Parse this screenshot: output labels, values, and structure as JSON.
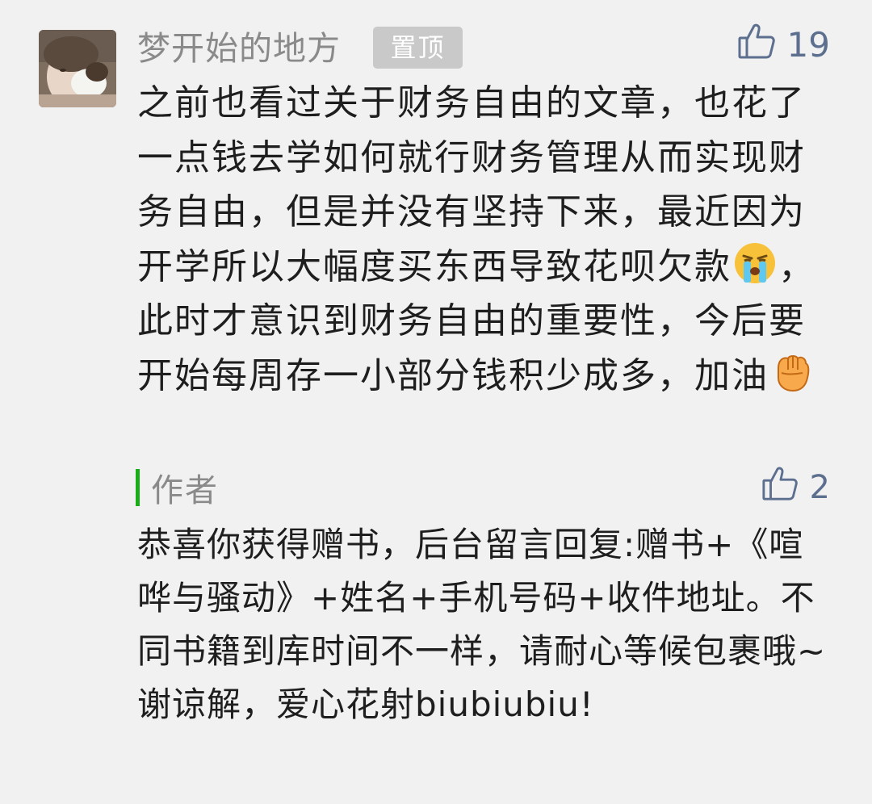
{
  "comment": {
    "nickname": "梦开始的地方",
    "pin_badge": "置顶",
    "like_count": "19",
    "text_part1": "之前也看过关于财务自由的文章，也花了一点钱去学如何就行财务管理从而实现财务自由，但是并没有坚持下来，最近因为开学所以大幅度买东西导致花呗欠款",
    "emoji1": "crying-face-icon",
    "text_part2": "，此时才意识到财务自由的重要性，今后要开始每周存一小部分钱积少成多，加油",
    "emoji2": "fist-icon"
  },
  "reply": {
    "author_label": "作者",
    "like_count": "2",
    "text": "恭喜你获得赠书，后台留言回复:赠书+《喧哗与骚动》+姓名+手机号码+收件地址。不同书籍到库时间不一样，请耐心等候包裹哦~谢谅解，爱心花射biubiubiu!"
  },
  "colors": {
    "background": "#f1f1f1",
    "nickname": "#8a8a8a",
    "badge_bg": "#c9c9c9",
    "like": "#5d6f8e",
    "author_bar": "#1aad19",
    "text": "#1e1e1e"
  }
}
